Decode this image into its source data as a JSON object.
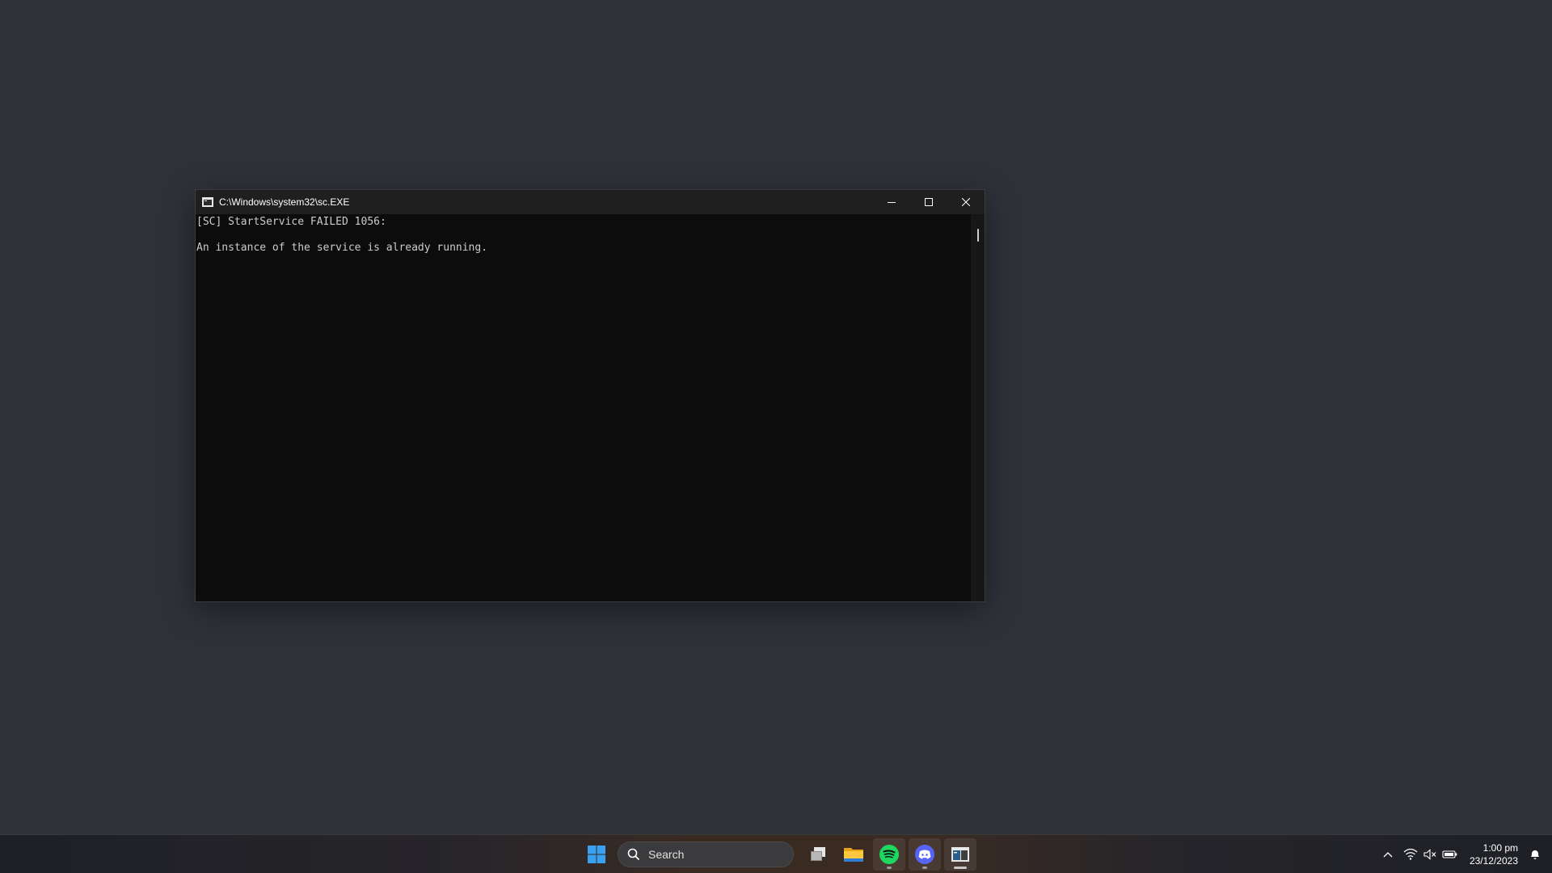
{
  "window": {
    "title": "C:\\Windows\\system32\\sc.EXE",
    "icon": "console-app-icon"
  },
  "console": {
    "lines": [
      "[SC] StartService FAILED 1056:",
      "",
      "An instance of the service is already running."
    ]
  },
  "taskbar": {
    "search_placeholder": "Search",
    "apps": [
      "start-icon",
      "task-view-icon",
      "file-explorer-icon",
      "spotify-icon",
      "discord-icon",
      "console-app-icon"
    ],
    "clock": {
      "time": "1:00 pm",
      "date": "23/12/2023"
    }
  },
  "colors": {
    "desktop": "#30323a",
    "console_bg": "#0c0c0c",
    "console_text": "#cccccc",
    "spotify": "#1ed760",
    "discord": "#5865f2",
    "start_blue": "#3aa0f0"
  }
}
